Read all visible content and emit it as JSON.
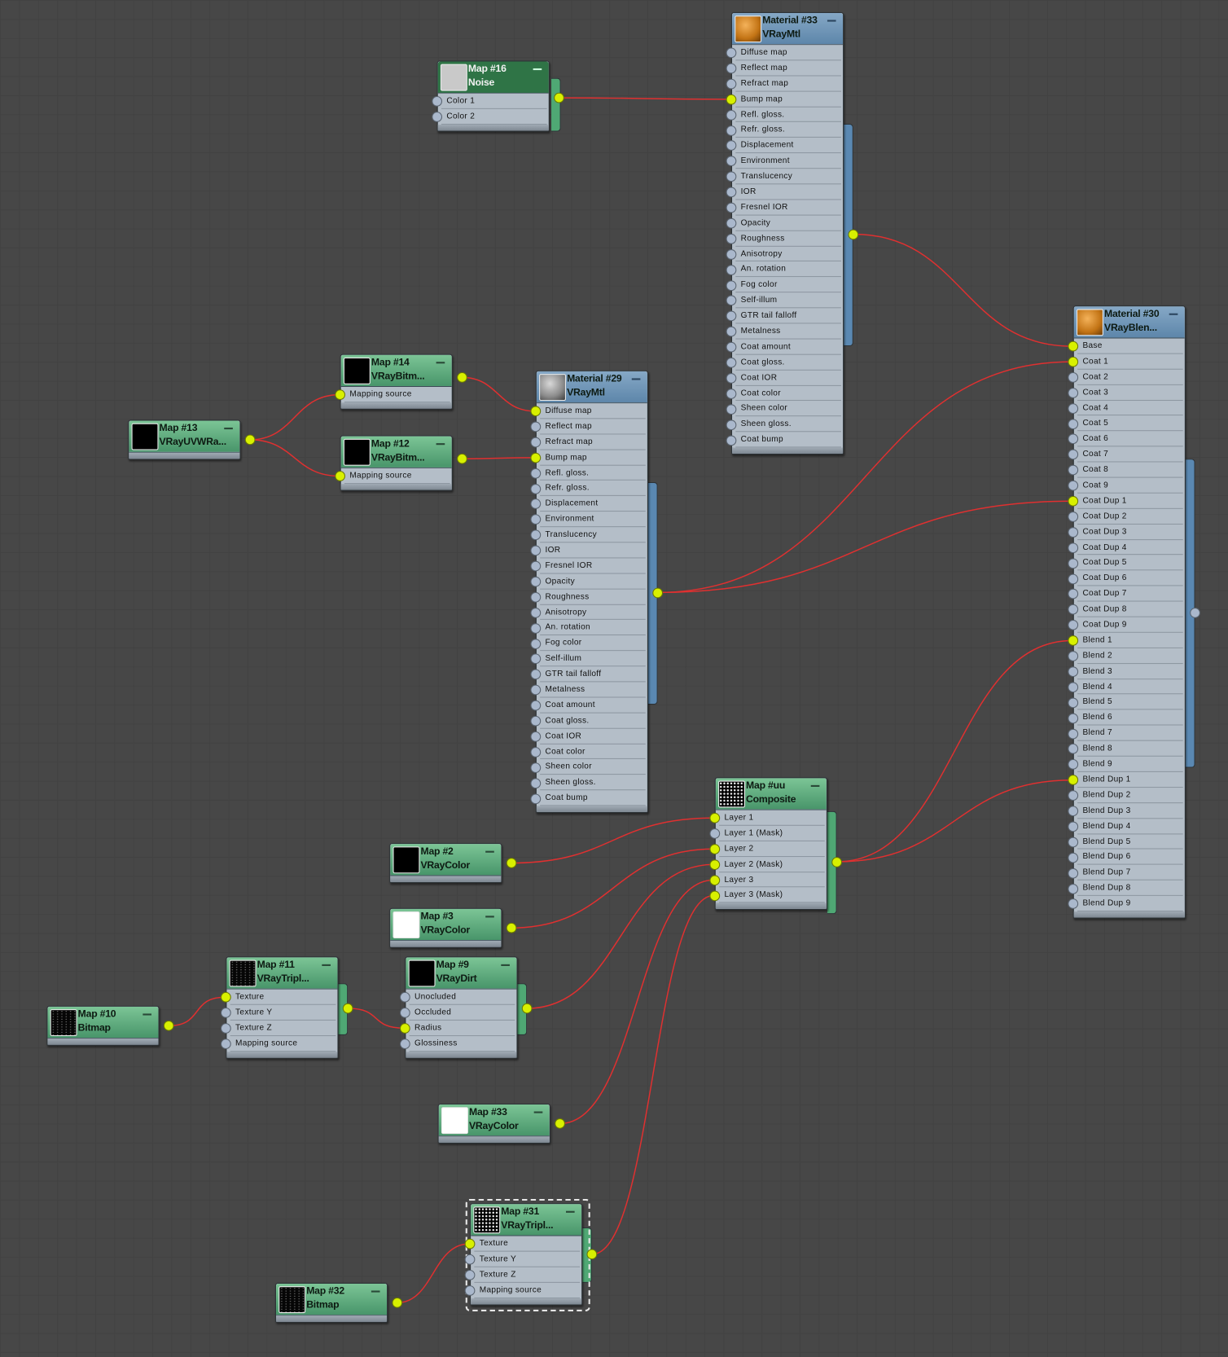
{
  "editor": {
    "wire_color": "#e03030",
    "socket_connected_color": "#d8f000",
    "socket_empty_color": "#aab8cc",
    "material_header_color": "#5d86aa",
    "map_header_color": "#48956a"
  },
  "nodes": [
    {
      "id": "mat33",
      "kind": "mtl",
      "thumb": "orange",
      "title": "Material #33",
      "subtitle": "VRayMtl",
      "ports": [
        "Diffuse map",
        "Reflect map",
        "Refract map",
        "Bump map",
        "Refl. gloss.",
        "Refr. gloss.",
        "Displacement",
        "Environment",
        "Translucency",
        "IOR",
        "Fresnel IOR",
        "Opacity",
        "Roughness",
        "Anisotropy",
        "An. rotation",
        "Fog color",
        "Self-illum",
        "GTR tail falloff",
        "Metalness",
        "Coat amount",
        "Coat gloss.",
        "Coat IOR",
        "Coat color",
        "Sheen color",
        "Sheen gloss.",
        "Coat bump"
      ],
      "connected": [
        "Bump map"
      ],
      "output_connected": true
    },
    {
      "id": "map16",
      "kind": "map",
      "selected": true,
      "thumb": "noise",
      "title": "Map #16",
      "subtitle": "Noise",
      "ports": [
        "Color 1",
        "Color 2"
      ],
      "connected": [],
      "output_connected": true
    },
    {
      "id": "mat30",
      "kind": "mtl",
      "thumb": "orange",
      "title": "Material #30",
      "subtitle": "VRayBlen...",
      "ports": [
        "Base",
        "Coat 1",
        "Coat 2",
        "Coat 3",
        "Coat 4",
        "Coat 5",
        "Coat 6",
        "Coat 7",
        "Coat 8",
        "Coat 9",
        "Coat Dup 1",
        "Coat Dup 2",
        "Coat Dup 3",
        "Coat Dup 4",
        "Coat Dup 5",
        "Coat Dup 6",
        "Coat Dup 7",
        "Coat Dup 8",
        "Coat Dup 9",
        "Blend 1",
        "Blend 2",
        "Blend 3",
        "Blend 4",
        "Blend 5",
        "Blend 6",
        "Blend 7",
        "Blend 8",
        "Blend 9",
        "Blend Dup 1",
        "Blend Dup 2",
        "Blend Dup 3",
        "Blend Dup 4",
        "Blend Dup 5",
        "Blend Dup 6",
        "Blend Dup 7",
        "Blend Dup 8",
        "Blend Dup 9"
      ],
      "connected": [
        "Base",
        "Coat 1",
        "Coat Dup 1",
        "Blend 1",
        "Blend Dup 1"
      ],
      "output_connected": false
    },
    {
      "id": "mat29",
      "kind": "mtl",
      "thumb": "grey",
      "title": "Material #29",
      "subtitle": "VRayMtl",
      "ports": [
        "Diffuse map",
        "Reflect map",
        "Refract map",
        "Bump map",
        "Refl. gloss.",
        "Refr. gloss.",
        "Displacement",
        "Environment",
        "Translucency",
        "IOR",
        "Fresnel IOR",
        "Opacity",
        "Roughness",
        "Anisotropy",
        "An. rotation",
        "Fog color",
        "Self-illum",
        "GTR tail falloff",
        "Metalness",
        "Coat amount",
        "Coat gloss.",
        "Coat IOR",
        "Coat color",
        "Sheen color",
        "Sheen gloss.",
        "Coat bump"
      ],
      "connected": [
        "Diffuse map",
        "Bump map"
      ],
      "output_connected": true
    },
    {
      "id": "map14",
      "kind": "map",
      "thumb": "black",
      "title": "Map #14",
      "subtitle": "VRayBitm...",
      "ports": [
        "Mapping source"
      ],
      "connected": [
        "Mapping source"
      ],
      "output_connected": true
    },
    {
      "id": "map12",
      "kind": "map",
      "thumb": "black",
      "title": "Map #12",
      "subtitle": "VRayBitm...",
      "ports": [
        "Mapping source"
      ],
      "connected": [
        "Mapping source"
      ],
      "output_connected": true
    },
    {
      "id": "map13",
      "kind": "map",
      "thumb": "black",
      "title": "Map #13",
      "subtitle": "VRayUVWRa...",
      "ports": [],
      "connected": [],
      "output_connected": true
    },
    {
      "id": "mapuu",
      "kind": "map",
      "thumb": "checker",
      "title": "Map #uu",
      "subtitle": "Composite",
      "ports": [
        "Layer 1",
        "Layer 1 (Mask)",
        "Layer 2",
        "Layer 2 (Mask)",
        "Layer 3",
        "Layer 3 (Mask)"
      ],
      "connected": [
        "Layer 1",
        "Layer 2",
        "Layer 2 (Mask)",
        "Layer 3",
        "Layer 3 (Mask)"
      ],
      "output_connected": true
    },
    {
      "id": "map2",
      "kind": "map",
      "thumb": "black",
      "title": "Map #2",
      "subtitle": "VRayColor",
      "ports": [],
      "connected": [],
      "output_connected": true
    },
    {
      "id": "map3",
      "kind": "map",
      "thumb": "white",
      "title": "Map #3",
      "subtitle": "VRayColor",
      "ports": [],
      "connected": [],
      "output_connected": true
    },
    {
      "id": "map11",
      "kind": "map",
      "thumb": "speck",
      "title": "Map #11",
      "subtitle": "VRayTripl...",
      "ports": [
        "Texture",
        "Texture Y",
        "Texture Z",
        "Mapping source"
      ],
      "connected": [
        "Texture"
      ],
      "output_connected": true
    },
    {
      "id": "map10",
      "kind": "map",
      "thumb": "speck",
      "title": "Map #10",
      "subtitle": "Bitmap",
      "ports": [],
      "connected": [],
      "output_connected": true
    },
    {
      "id": "map9",
      "kind": "map",
      "thumb": "black",
      "title": "Map #9",
      "subtitle": "VRayDirt",
      "ports": [
        "Unocluded",
        "Occluded",
        "Radius",
        "Glossiness"
      ],
      "connected": [
        "Radius"
      ],
      "output_connected": true
    },
    {
      "id": "map33",
      "kind": "map",
      "thumb": "white",
      "title": "Map #33",
      "subtitle": "VRayColor",
      "ports": [],
      "connected": [],
      "output_connected": true
    },
    {
      "id": "map31",
      "kind": "map",
      "thumb": "checker",
      "selected_outline": true,
      "title": "Map #31",
      "subtitle": "VRayTripl...",
      "ports": [
        "Texture",
        "Texture Y",
        "Texture Z",
        "Mapping source"
      ],
      "connected": [
        "Texture"
      ],
      "output_connected": true
    },
    {
      "id": "map32",
      "kind": "map",
      "thumb": "speck",
      "title": "Map #32",
      "subtitle": "Bitmap",
      "ports": [],
      "connected": [],
      "output_connected": true
    }
  ],
  "connections": [
    {
      "from": "map16",
      "to": "mat33",
      "port": "Bump map"
    },
    {
      "from": "mat33",
      "to": "mat30",
      "port": "Base"
    },
    {
      "from": "mat29",
      "to": "mat30",
      "port": "Coat 1"
    },
    {
      "from": "mat29",
      "to": "mat30",
      "port": "Coat Dup 1"
    },
    {
      "from": "mapuu",
      "to": "mat30",
      "port": "Blend 1"
    },
    {
      "from": "mapuu",
      "to": "mat30",
      "port": "Blend Dup 1"
    },
    {
      "from": "map13",
      "to": "map14",
      "port": "Mapping source"
    },
    {
      "from": "map13",
      "to": "map12",
      "port": "Mapping source"
    },
    {
      "from": "map14",
      "to": "mat29",
      "port": "Diffuse map"
    },
    {
      "from": "map12",
      "to": "mat29",
      "port": "Bump map"
    },
    {
      "from": "map2",
      "to": "mapuu",
      "port": "Layer 1"
    },
    {
      "from": "map3",
      "to": "mapuu",
      "port": "Layer 2"
    },
    {
      "from": "map9",
      "to": "mapuu",
      "port": "Layer 2 (Mask)"
    },
    {
      "from": "map33",
      "to": "mapuu",
      "port": "Layer 3"
    },
    {
      "from": "map31",
      "to": "mapuu",
      "port": "Layer 3 (Mask)"
    },
    {
      "from": "map10",
      "to": "map11",
      "port": "Texture"
    },
    {
      "from": "map11",
      "to": "map9",
      "port": "Radius"
    },
    {
      "from": "map32",
      "to": "map31",
      "port": "Texture"
    }
  ]
}
